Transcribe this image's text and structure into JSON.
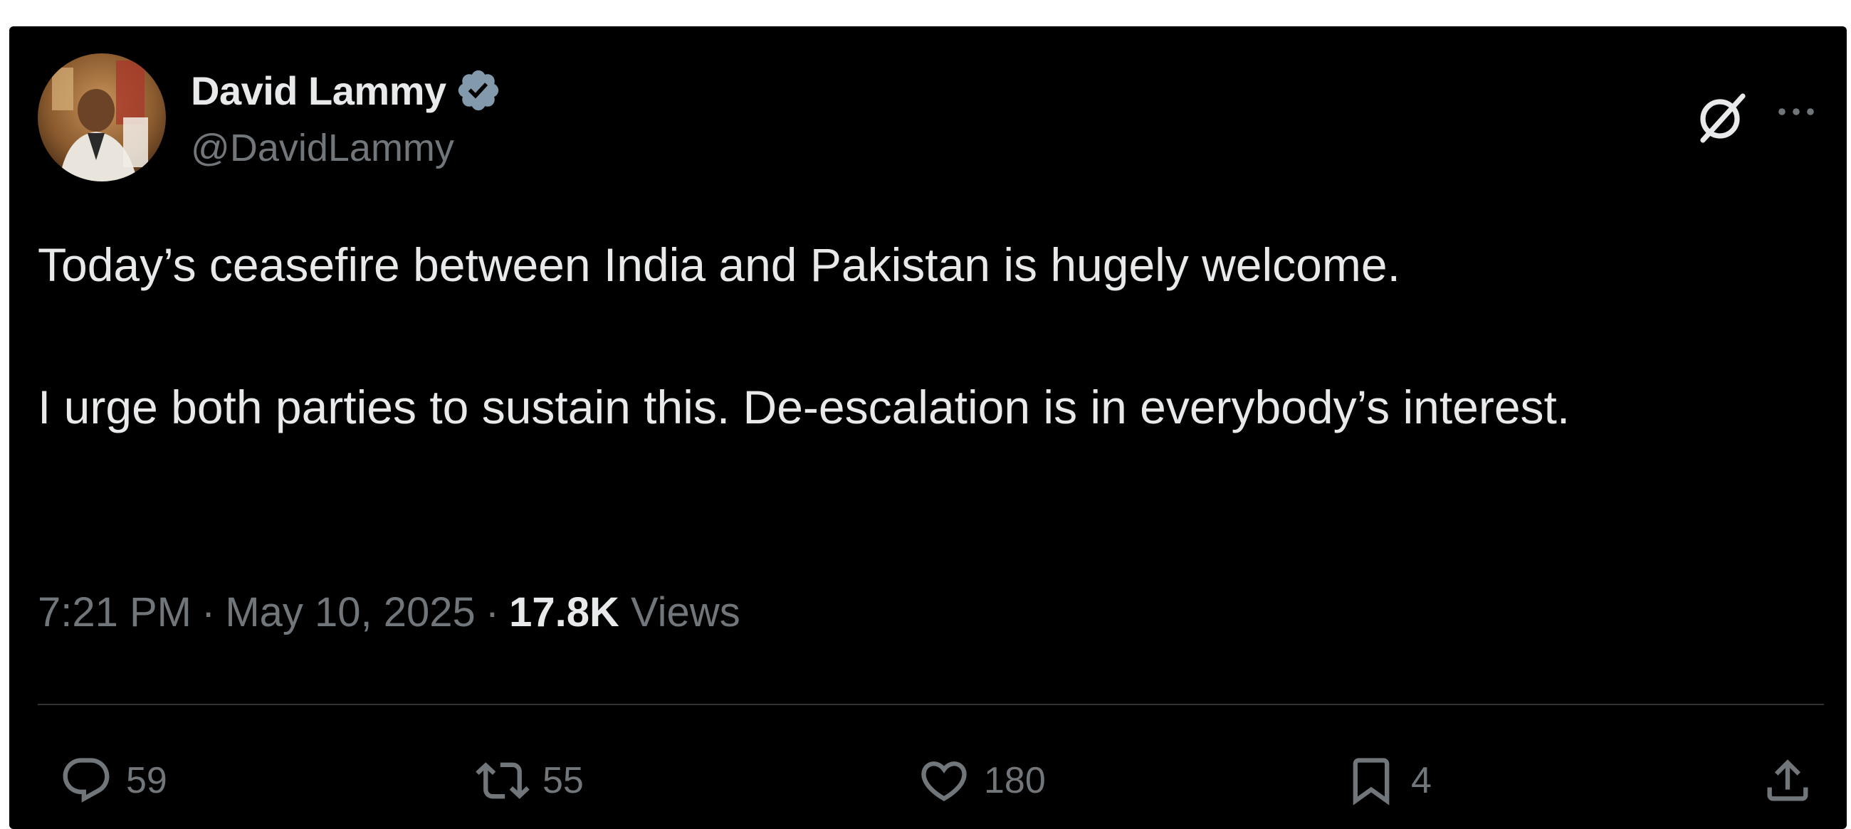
{
  "author": {
    "display_name": "David Lammy",
    "handle": "@DavidLammy",
    "verified": true
  },
  "tweet": {
    "paragraphs": [
      "Today’s ceasefire between India and Pakistan is hugely welcome.",
      "I urge both parties to sustain this. De-escalation is in everybody’s interest."
    ],
    "time": "7:21 PM",
    "date": "May 10, 2025",
    "separator": "·",
    "views_count": "17.8K",
    "views_label": "Views"
  },
  "actions": {
    "replies": "59",
    "reposts": "55",
    "likes": "180",
    "bookmarks": "4"
  },
  "icons": {
    "header": [
      "grok-icon",
      "more-icon"
    ],
    "actions": [
      "reply-icon",
      "repost-icon",
      "like-icon",
      "bookmark-icon",
      "share-icon"
    ]
  },
  "colors": {
    "background": "#000000",
    "primary_text": "#e7e9ea",
    "secondary_text": "#71767b",
    "verified_badge": "#829aab",
    "divider": "#2f3336"
  }
}
